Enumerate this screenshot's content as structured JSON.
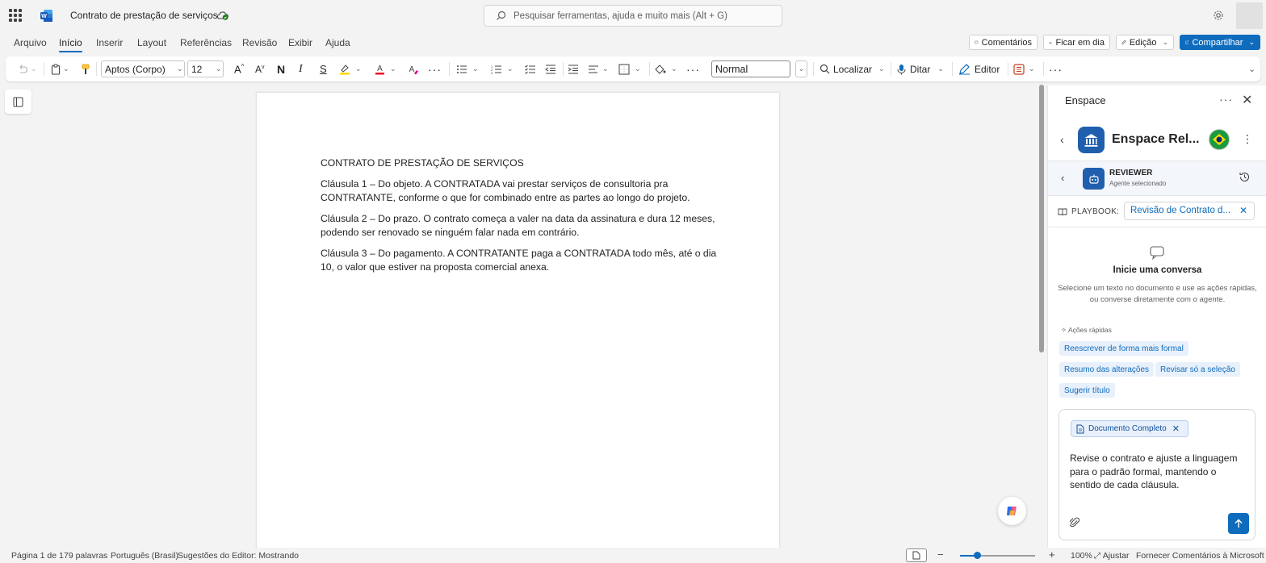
{
  "app": {
    "doc_title": "Contrato de prestação de serviços",
    "search_placeholder": "Pesquisar ferramentas, ajuda e muito mais (Alt + G)"
  },
  "menu": {
    "tabs": [
      {
        "label": "Arquivo",
        "active": false
      },
      {
        "label": "Início",
        "active": true
      },
      {
        "label": "Inserir",
        "active": false
      },
      {
        "label": "Layout",
        "active": false
      },
      {
        "label": "Referências",
        "active": false
      },
      {
        "label": "Revisão",
        "active": false
      },
      {
        "label": "Exibir",
        "active": false
      },
      {
        "label": "Ajuda",
        "active": false
      }
    ],
    "comments_label": "Comentários",
    "meeting_label": "Ficar em dia",
    "editing_label": "Edição",
    "share_label": "Compartilhar"
  },
  "ribbon": {
    "font_name": "Aptos (Corpo)",
    "font_size": "12",
    "bold_glyph": "N",
    "italic_glyph": "I",
    "strike_glyph": "S",
    "style_value": "Normal",
    "find_label": "Localizar",
    "dictate_label": "Ditar",
    "editor_label": "Editor"
  },
  "document": {
    "heading": "CONTRATO DE PRESTAÇÃO DE SERVIÇOS",
    "paragraphs": [
      "Cláusula 1 – Do objeto. A CONTRATADA vai prestar serviços de consultoria pra CONTRATANTE, conforme o que for combinado entre as partes ao longo do projeto.",
      "Cláusula 2 – Do prazo. O contrato começa a valer na data da assinatura e dura 12 meses, podendo ser renovado se ninguém falar nada em contrário.",
      "Cláusula 3 – Do pagamento. A CONTRATANTE paga a CONTRATADA todo mês, até o dia 10, o valor que estiver na proposta comercial anexa."
    ]
  },
  "panel": {
    "title": "Enspace",
    "app_name": "Enspace Rel...",
    "agent_name": "REVIEWER",
    "agent_sub": "Agente selecionado",
    "playbook_label": "PLAYBOOK:",
    "playbook_value": "Revisão de Contrato d...",
    "empty_title": "Inicie uma conversa",
    "empty_desc": "Selecione um texto no documento e use as ações rápidas, ou converse diretamente com o agente.",
    "quick_actions_label": "Ações rápidas",
    "quick_actions": [
      "Reescrever de forma mais formal",
      "Resumo das alterações",
      "Revisar só a seleção",
      "Sugerir título"
    ],
    "context_chip": "Documento Completo",
    "composer_text": "Revise o contrato e ajuste a linguagem para o padrão formal, mantendo o sentido de cada cláusula."
  },
  "status": {
    "page": "Página 1 de 1",
    "words": "79 palavras",
    "language": "Português (Brasil)",
    "editor": "Sugestões do Editor: Mostrando",
    "zoom_minus": "−",
    "zoom_plus": "+",
    "zoom": "100%",
    "fit": "Ajustar",
    "feedback": "Fornecer Comentários à Microsoft"
  },
  "colors": {
    "accent": "#0f6cbd",
    "brand_panel": "#1f5fad",
    "font_color_bar": "#e81123",
    "highlight_bar": "#ffd700"
  }
}
